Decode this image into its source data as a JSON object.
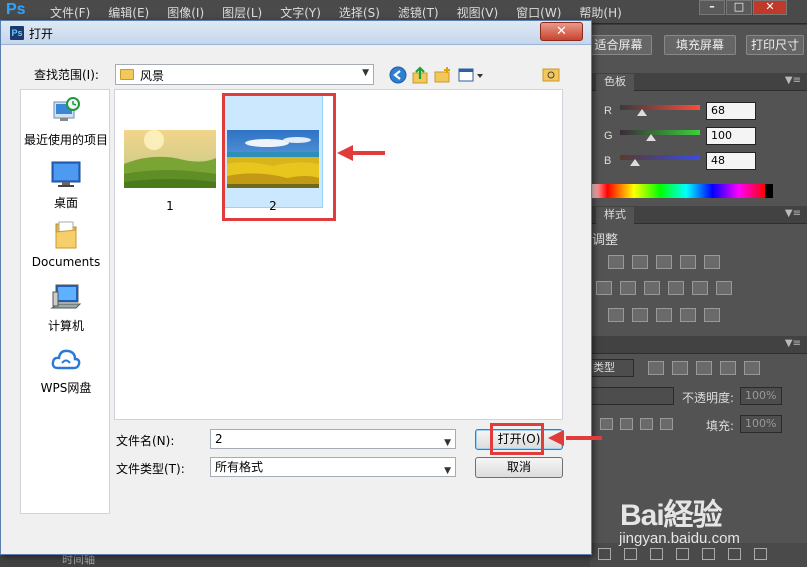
{
  "ps": {
    "logo": "Ps",
    "menu": [
      "文件(F)",
      "编辑(E)",
      "图像(I)",
      "图层(L)",
      "文字(Y)",
      "选择(S)",
      "滤镜(T)",
      "视图(V)",
      "窗口(W)",
      "帮助(H)"
    ],
    "window_controls": [
      "–",
      "□",
      "✕"
    ],
    "options": {
      "fit_screen": "适合屏幕",
      "fill_screen": "填充屏幕",
      "print_size": "打印尺寸"
    },
    "color_panel": {
      "tab": "色板",
      "channels": [
        {
          "label": "R",
          "value": "68",
          "level": 0.27,
          "gradient": [
            "#3a3a3a",
            "#ff4b3a"
          ]
        },
        {
          "label": "G",
          "value": "100",
          "level": 0.39,
          "gradient": [
            "#3a2a3a",
            "#3ad23a"
          ]
        },
        {
          "label": "B",
          "value": "48",
          "level": 0.19,
          "gradient": [
            "#5a3a2a",
            "#3a4ae8"
          ]
        }
      ]
    },
    "adjust_panel": {
      "tab": "样式",
      "heading": "调整"
    },
    "layers_panel": {
      "kind_value": "类型",
      "opacity_label": "不透明度:",
      "opacity_value": "100%",
      "fill_label": "填充:",
      "fill_value": "100%"
    },
    "status_text": "时间轴"
  },
  "dialog": {
    "title": "打开",
    "close": "✕",
    "look_in_label": "查找范围(I):",
    "look_in_value": "风景",
    "places": [
      {
        "label": "最近使用的项目",
        "icon": "recent-items-icon"
      },
      {
        "label": "桌面",
        "icon": "desktop-icon"
      },
      {
        "label": "Documents",
        "icon": "documents-folder-icon"
      },
      {
        "label": "计算机",
        "icon": "computer-icon"
      },
      {
        "label": "WPS网盘",
        "icon": "wps-cloud-icon"
      }
    ],
    "files": [
      {
        "name": "1",
        "selected": false
      },
      {
        "name": "2",
        "selected": true
      }
    ],
    "filename_label": "文件名(N):",
    "filename_value": "2",
    "filetype_label": "文件类型(T):",
    "filetype_value": "所有格式",
    "open_button": "打开(O)",
    "cancel_button": "取消"
  },
  "watermark": {
    "brand": "Bai経验",
    "url": "jingyan.baidu.com"
  },
  "colors": {
    "highlight_red": "#e03c3c",
    "selection_blue": "#cce8ff"
  }
}
